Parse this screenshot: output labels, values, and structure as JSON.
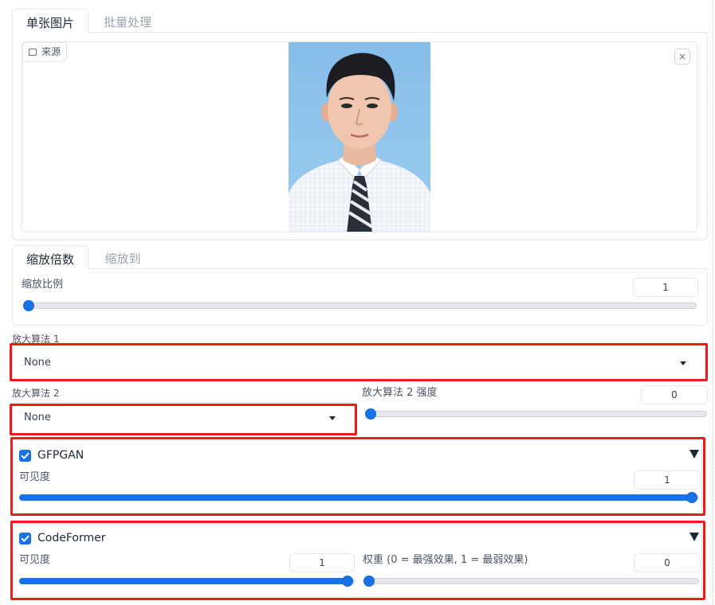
{
  "top_tabs": [
    {
      "label": "单张图片"
    },
    {
      "label": "批量处理"
    }
  ],
  "image_input": {
    "source_label": "来源",
    "close_symbol": "×"
  },
  "scale_tabs": [
    {
      "label": "缩放倍数"
    },
    {
      "label": "缩放到"
    }
  ],
  "scale_ratio": {
    "label": "缩放比例",
    "value": "1",
    "fraction": 0.0
  },
  "upscaler1": {
    "label": "放大算法 1",
    "selected": "None"
  },
  "upscaler2": {
    "label": "放大算法 2",
    "selected": "None"
  },
  "upscaler2_strength": {
    "label": "放大算法 2 强度",
    "value": "0",
    "fraction": 0.0
  },
  "gfpgan": {
    "title": "GFPGAN",
    "checked": true,
    "visibility_label": "可见度",
    "visibility_value": "1",
    "visibility_fraction": 1.0
  },
  "codeformer": {
    "title": "CodeFormer",
    "checked": true,
    "visibility_label": "可见度",
    "visibility_value": "1",
    "visibility_fraction": 1.0,
    "weight_label": "权重 (0 = 最强效果, 1 = 最弱效果)",
    "weight_value": "0",
    "weight_fraction": 0.0
  },
  "colors": {
    "accent": "#1672e6",
    "highlight": "#ee1b1b"
  }
}
